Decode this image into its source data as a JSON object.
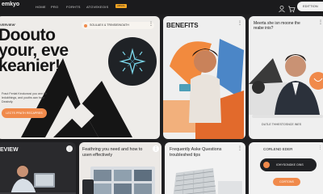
{
  "header": {
    "logo": "emkyo",
    "nav": [
      "HOME",
      "PRO",
      "FORHTS",
      "ATOVEKEOIS"
    ],
    "nav_cta": "ABSOL",
    "cta_button": "EDITTION"
  },
  "hero": {
    "kicker": "VERVIEW'",
    "title_lines": [
      "Doouto",
      "your, eve",
      "keanier!"
    ],
    "description": "Fraut Fenlat Keokonosi you ann tor ledukthings, and youths aan hour Deatrofy.",
    "cta": "LECTS PRATH RECAPRES",
    "badge": "SOULAEX & TRINSIEINOATH"
  },
  "benefits": {
    "title": "BENEFITS"
  },
  "meet": {
    "title": "Meerta she isn moone the reabe inis?",
    "caption": "DUTLE THHESTOSNCE INES"
  },
  "review": {
    "title": "EVIEW"
  },
  "feature": {
    "title": "Feathring you need and how to usen effectively"
  },
  "faq": {
    "title": "Frequently Aske Questions troubleshed tips"
  },
  "contact": {
    "title": "CORLEND EDER",
    "pill_label": "IOHYSONDKE OINS",
    "button": "CORTONS"
  },
  "colors": {
    "accent": "#f08a4b",
    "dark": "#1f1f21",
    "card_light": "#efefef"
  }
}
